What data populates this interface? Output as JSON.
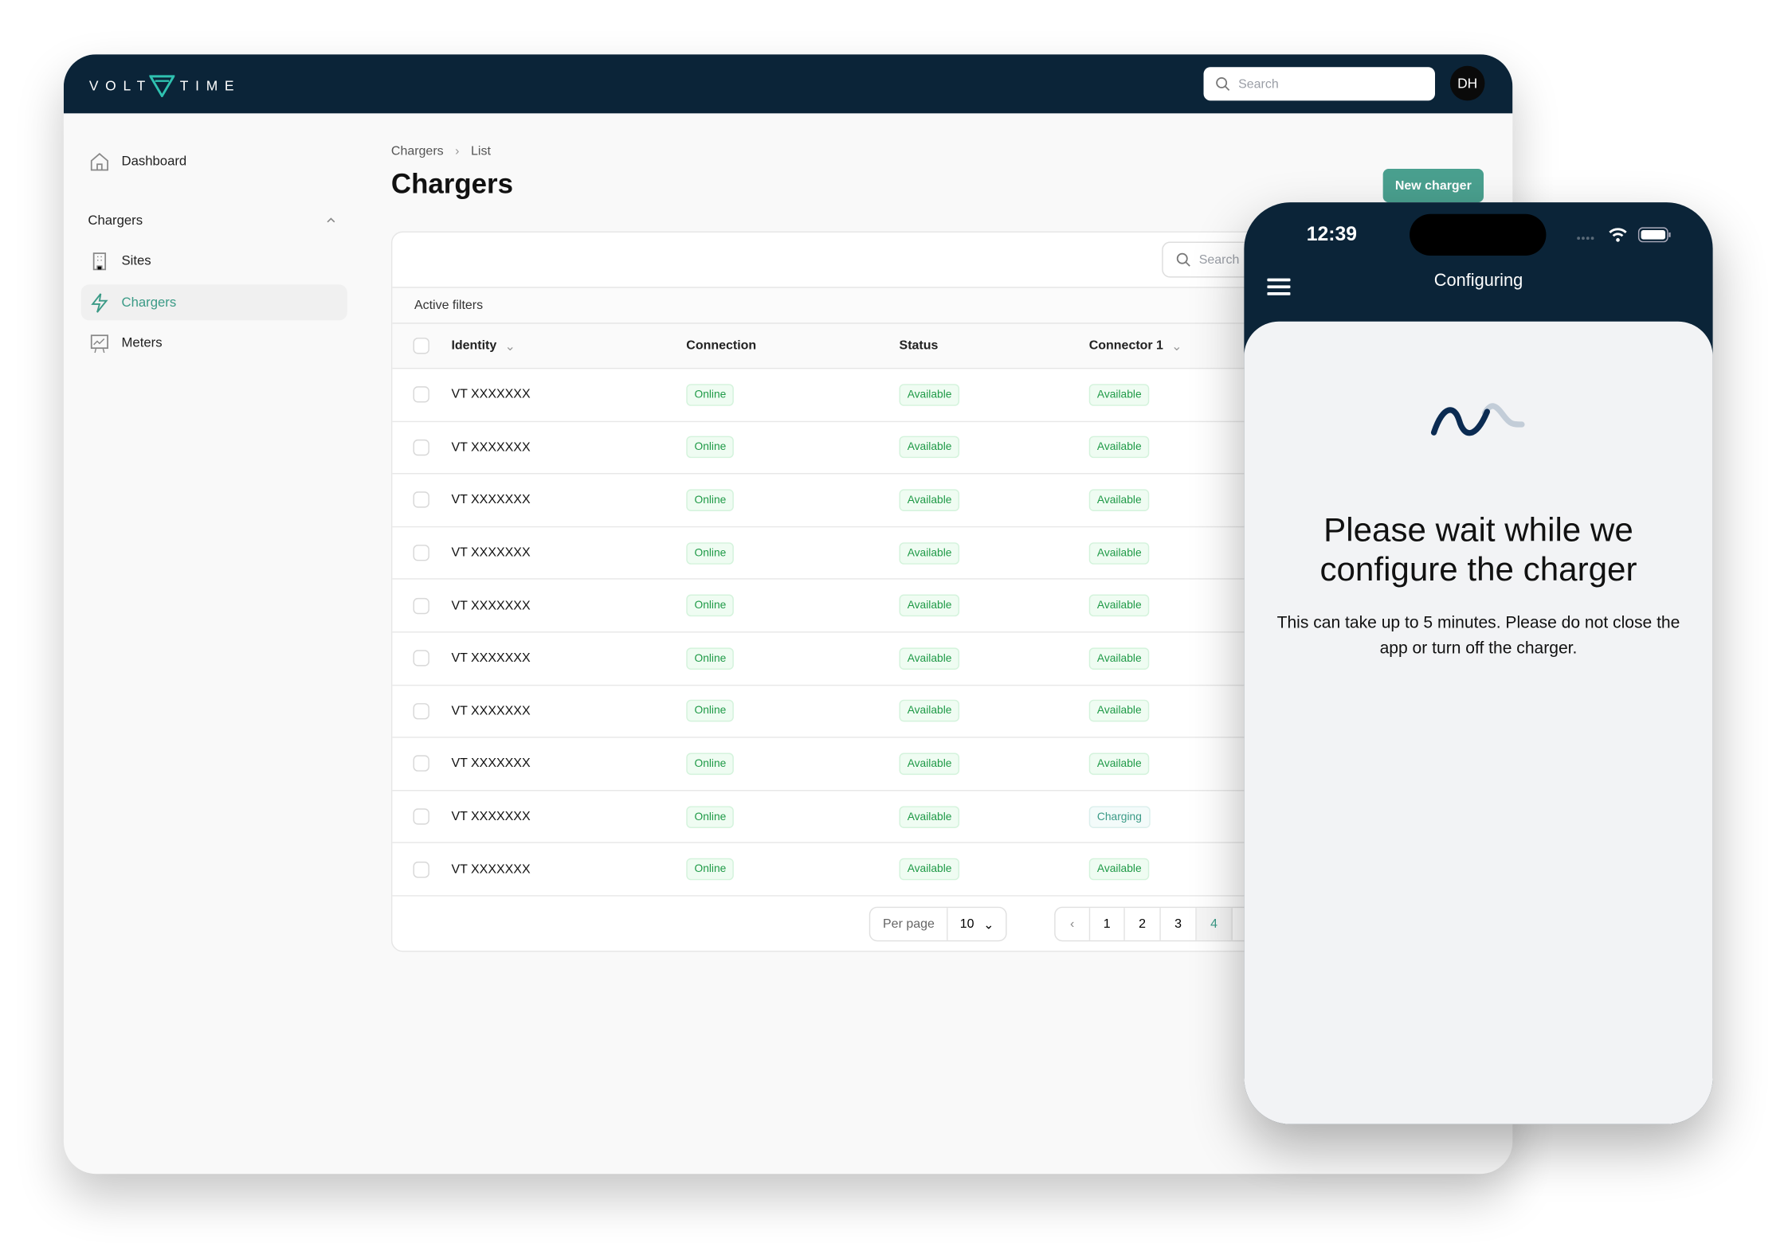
{
  "brand": {
    "logo_text_left": "VOLT",
    "logo_text_right": "TIME",
    "accent": "#4aa08f",
    "navy": "#0b2438"
  },
  "header": {
    "search_placeholder": "Search",
    "avatar_initials": "DH"
  },
  "sidebar": {
    "dashboard": "Dashboard",
    "section": "Chargers",
    "items": [
      {
        "label": "Sites",
        "icon": "building-icon"
      },
      {
        "label": "Chargers",
        "icon": "bolt-icon",
        "active": true
      },
      {
        "label": "Meters",
        "icon": "chart-board-icon"
      }
    ]
  },
  "breadcrumb": [
    "Chargers",
    "List"
  ],
  "page_title": "Chargers",
  "new_button": "New charger",
  "table": {
    "search_placeholder": "Search",
    "active_filters": "Active filters",
    "columns": [
      "Identity",
      "Connection",
      "Status",
      "Connector 1"
    ],
    "rows": [
      {
        "identity": "VT XXXXXXX",
        "connection": "Online",
        "status": "Available",
        "connector": "Available"
      },
      {
        "identity": "VT XXXXXXX",
        "connection": "Online",
        "status": "Available",
        "connector": "Available"
      },
      {
        "identity": "VT XXXXXXX",
        "connection": "Online",
        "status": "Available",
        "connector": "Available"
      },
      {
        "identity": "VT XXXXXXX",
        "connection": "Online",
        "status": "Available",
        "connector": "Available"
      },
      {
        "identity": "VT XXXXXXX",
        "connection": "Online",
        "status": "Available",
        "connector": "Available"
      },
      {
        "identity": "VT XXXXXXX",
        "connection": "Online",
        "status": "Available",
        "connector": "Available"
      },
      {
        "identity": "VT XXXXXXX",
        "connection": "Online",
        "status": "Available",
        "connector": "Available"
      },
      {
        "identity": "VT XXXXXXX",
        "connection": "Online",
        "status": "Available",
        "connector": "Available"
      },
      {
        "identity": "VT XXXXXXX",
        "connection": "Online",
        "status": "Available",
        "connector": "Charging"
      },
      {
        "identity": "VT XXXXXXX",
        "connection": "Online",
        "status": "Available",
        "connector": "Available"
      }
    ]
  },
  "pagination": {
    "per_page_label": "Per page",
    "per_page_value": "10",
    "pages": [
      "1",
      "2",
      "3",
      "4"
    ],
    "current": "4"
  },
  "phone": {
    "time": "12:39",
    "title": "Configuring",
    "heading": "Please wait while we configure the charger",
    "message": "This can take up to 5 minutes. Please do not close the app or turn off the charger."
  }
}
